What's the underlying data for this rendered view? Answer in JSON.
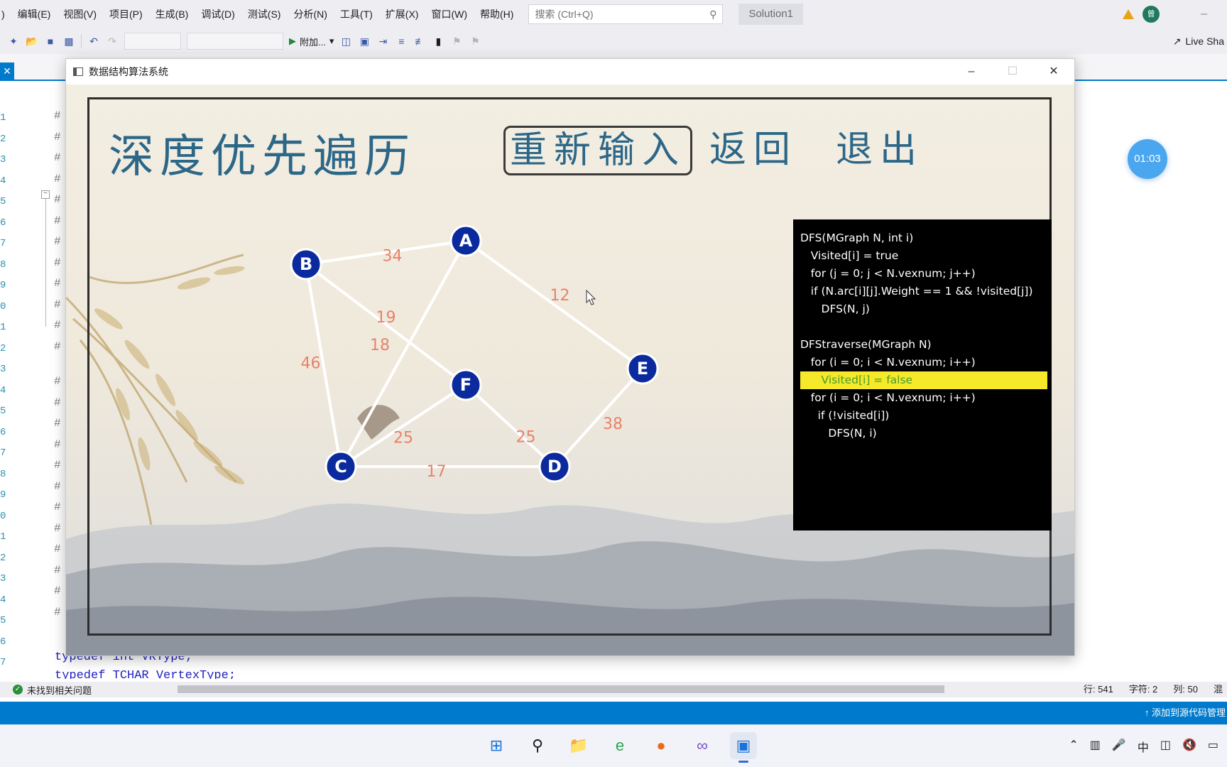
{
  "ide": {
    "menu": [
      ")",
      "编辑(E)",
      "视图(V)",
      "项目(P)",
      "生成(B)",
      "调试(D)",
      "测试(S)",
      "分析(N)",
      "工具(T)",
      "扩展(X)",
      "窗口(W)",
      "帮助(H)"
    ],
    "search_placeholder": "搜索 (Ctrl+Q)",
    "solution_name": "Solution1",
    "user_initials": "曾",
    "attach_label": "附加...",
    "live_share": "Live Sha",
    "code_lines": [
      "typedef int VRType;",
      "typedef TCHAR VertexType;"
    ],
    "line_gutter": [
      "1",
      "2",
      "3",
      "4",
      "5",
      "6",
      "7",
      "8",
      "9",
      "0",
      "1",
      "2",
      "3",
      "4",
      "5",
      "6",
      "7",
      "8",
      "9",
      "0",
      "1",
      "2",
      "3",
      "4",
      "5",
      "6",
      "7"
    ],
    "status_message": "未找到相关问题",
    "position": {
      "row": "行: 541",
      "char": "字符: 2",
      "col": "列: 50",
      "ins": "混"
    },
    "source_control": "添加到源代码管理",
    "tray_ime": "中"
  },
  "app": {
    "window_title": "数据结构算法系统",
    "page_title": "深度优先遍历",
    "buttons": {
      "reinput": "重新输入",
      "back": "返回",
      "exit": "退出"
    },
    "graph": {
      "nodes": [
        {
          "id": "A",
          "label": "A"
        },
        {
          "id": "B",
          "label": "B"
        },
        {
          "id": "C",
          "label": "C"
        },
        {
          "id": "D",
          "label": "D"
        },
        {
          "id": "E",
          "label": "E"
        },
        {
          "id": "F",
          "label": "F"
        }
      ],
      "edges": [
        {
          "from": "A",
          "to": "B",
          "weight": "34"
        },
        {
          "from": "A",
          "to": "E",
          "weight": "12"
        },
        {
          "from": "B",
          "to": "F",
          "weight": "19"
        },
        {
          "from": "A",
          "to": "C",
          "weight": "18"
        },
        {
          "from": "B",
          "to": "C",
          "weight": "46"
        },
        {
          "from": "C",
          "to": "F",
          "weight": "25"
        },
        {
          "from": "F",
          "to": "D",
          "weight": "25"
        },
        {
          "from": "E",
          "to": "D",
          "weight": "38"
        },
        {
          "from": "C",
          "to": "D",
          "weight": "17"
        }
      ],
      "node_color": "#0a2a9e",
      "edge_color": "#ffffff",
      "weight_color": "#e8826a"
    },
    "code": [
      "DFS(MGraph N, int i)",
      "   Visited[i] = true",
      "   for (j = 0; j < N.vexnum; j++)",
      "   if (N.arc[i][j].Weight == 1 && !visited[j])",
      "      DFS(N, j)",
      "",
      "DFStraverse(MGraph N)",
      "   for (i = 0; i < N.vexnum; i++)",
      "      Visited[i] = false",
      "   for (i = 0; i < N.vexnum; i++)",
      "     if (!visited[i])",
      "        DFS(N, i)"
    ],
    "highlight_line_index": 8,
    "highlight_color": "#f5e92a"
  },
  "timer": "01:03"
}
